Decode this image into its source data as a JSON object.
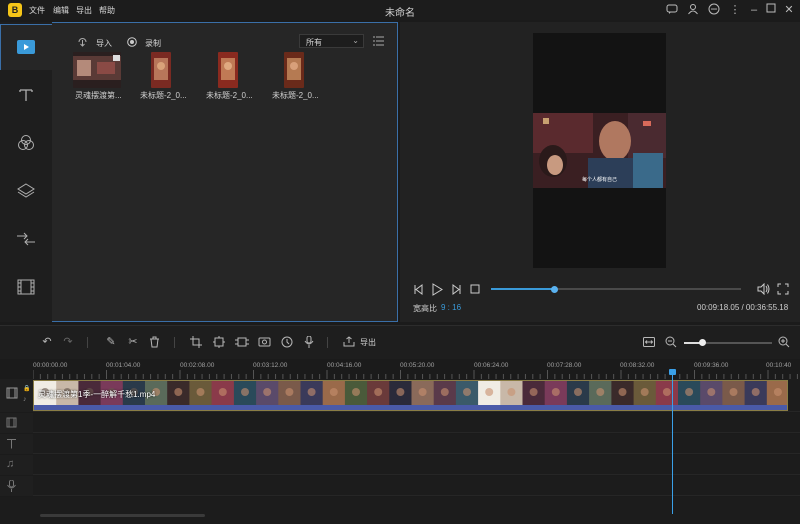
{
  "app": {
    "logo_text": "B",
    "menu": [
      "文件",
      "编辑",
      "导出",
      "帮助"
    ],
    "title": "未命名",
    "window_icons": [
      "chat-icon",
      "user-icon",
      "message-icon",
      "more-icon",
      "minimize-icon",
      "maximize-icon",
      "close-icon"
    ]
  },
  "rail": {
    "items": [
      "media-icon",
      "text-icon",
      "filter-icon",
      "overlay-icon",
      "transition-icon",
      "element-icon"
    ]
  },
  "media": {
    "import_label": "导入",
    "record_label": "录制",
    "filter_value": "所有",
    "items": [
      {
        "label": "灵魂摆渡第..."
      },
      {
        "label": "未标题-2_0..."
      },
      {
        "label": "未标题-2_0..."
      },
      {
        "label": "未标题-2_0..."
      }
    ]
  },
  "preview": {
    "subtitle": "每个人都有自己",
    "aspect_label": "宽高比",
    "aspect_value": "9 : 16",
    "time": "00:09:18.05 / 00:36:55.18",
    "progress": 0.25
  },
  "timeline": {
    "export_label": "导出",
    "ticks": [
      "00:00:00.00",
      "00:01:04.00",
      "00:02:08.00",
      "00:03:12.00",
      "00:04:16.00",
      "00:05:20.00",
      "00:06:24.00",
      "00:07:28.00",
      "00:08:32.00",
      "00:09:36.00",
      "00:10:40"
    ],
    "clip_label": "灵魂摆渡第1季-一醉解千愁1.mp4",
    "zoom": 0.2
  },
  "colors": {
    "accent": "#3a9ad9",
    "logo": "#f5c518",
    "panel_border": "#3a6fa8"
  }
}
